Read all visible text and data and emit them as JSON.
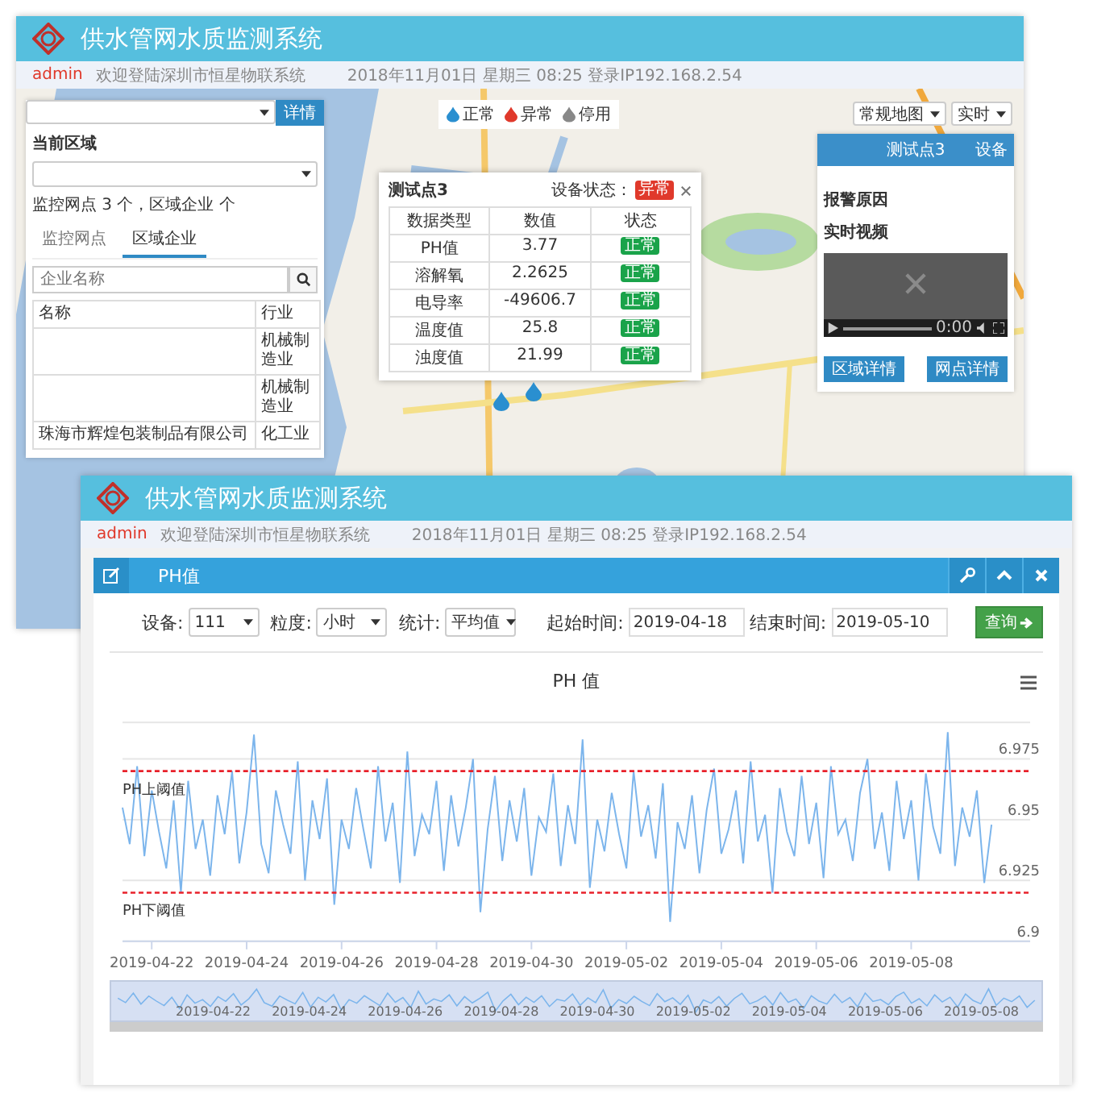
{
  "back_window": {
    "title": "供水管网水质监测系统",
    "info": {
      "user": "admin",
      "welcome": "欢迎登陆深圳市恒星物联系统",
      "session": "2018年11月01日 星期三 08:25 登录IP192.168.2.54"
    },
    "left_panel": {
      "detail_button": "详情",
      "area_label": "当前区域",
      "summary": "监控网点 3 个，区域企业 个",
      "tabs": [
        {
          "label": "监控网点",
          "selected": false
        },
        {
          "label": "区域企业",
          "selected": true
        }
      ],
      "search": {
        "placeholder": "企业名称"
      },
      "columns": [
        "名称",
        "行业"
      ],
      "rows": [
        {
          "industry": "机械制造业"
        },
        {
          "industry": "机械制造业"
        },
        {
          "name": "珠海市辉煌包装制品有限公司",
          "industry": "化工业"
        }
      ]
    },
    "legend": [
      {
        "label": "正常",
        "color": "#2a8fd0"
      },
      {
        "label": "异常",
        "color": "#e0392b"
      },
      {
        "label": "停用",
        "color": "#888888"
      }
    ],
    "map_controls": [
      "常规地图",
      "实时"
    ],
    "popup": {
      "title": "测试点3",
      "status_label": "设备状态：",
      "status": {
        "text": "异常",
        "color": "#e0392b"
      },
      "columns": [
        "数据类型",
        "数值",
        "状态"
      ],
      "rows": [
        {
          "type": "PH值",
          "value": "3.77",
          "status": "正常",
          "color": "#1aa34a"
        },
        {
          "type": "溶解氧",
          "value": "2.2625",
          "status": "正常",
          "color": "#1aa34a"
        },
        {
          "type": "电导率",
          "value": "-49606.7",
          "status": "正常",
          "color": "#1aa34a"
        },
        {
          "type": "温度值",
          "value": "25.8",
          "status": "正常",
          "color": "#1aa34a"
        },
        {
          "type": "浊度值",
          "value": "21.99",
          "status": "正常",
          "color": "#1aa34a"
        }
      ]
    },
    "station_panel": {
      "title": "测试点3",
      "link": "设备",
      "alarm_label": "报警原因",
      "video_label": "实时视频",
      "video_time": "0:00",
      "buttons": [
        "区域详情",
        "网点详情"
      ]
    }
  },
  "front_window": {
    "title": "供水管网水质监测系统",
    "info": {
      "user": "admin",
      "welcome": "欢迎登陆深圳市恒星物联系统",
      "session": "2018年11月01日 星期三 08:25 登录IP192.168.2.54"
    },
    "panel_title": "PH值",
    "filters": [
      {
        "kind": "select",
        "label": "设备:",
        "value": "111"
      },
      {
        "kind": "select",
        "label": "粒度:",
        "value": "小时"
      },
      {
        "kind": "select",
        "label": "统计:",
        "value": "平均值"
      },
      {
        "kind": "date",
        "label": "起始时间:",
        "value": "2019-04-18"
      },
      {
        "kind": "date",
        "label": "结束时间:",
        "value": "2019-05-10"
      }
    ],
    "query_button": "查询",
    "chart_data": {
      "type": "line",
      "title": "PH 值",
      "grid": true,
      "ylim": [
        6.9,
        6.99
      ],
      "categories": [
        null,
        null,
        null,
        null,
        "2019-04-22",
        null,
        null,
        null,
        null,
        null,
        null,
        null,
        null,
        null,
        null,
        null,
        null,
        "2019-04-24",
        null,
        null,
        null,
        null,
        null,
        null,
        null,
        null,
        null,
        null,
        null,
        null,
        "2019-04-26",
        null,
        null,
        null,
        null,
        null,
        null,
        null,
        null,
        null,
        null,
        null,
        null,
        "2019-04-28",
        null,
        null,
        null,
        null,
        null,
        null,
        null,
        null,
        null,
        null,
        null,
        null,
        "2019-04-30",
        null,
        null,
        null,
        null,
        null,
        null,
        null,
        null,
        null,
        null,
        null,
        null,
        "2019-05-02",
        null,
        null,
        null,
        null,
        null,
        null,
        null,
        null,
        null,
        null,
        null,
        null,
        "2019-05-04",
        null,
        null,
        null,
        null,
        null,
        null,
        null,
        null,
        null,
        null,
        null,
        null,
        "2019-05-06",
        null,
        null,
        null,
        null,
        null,
        null,
        null,
        null,
        null,
        null,
        null,
        null,
        "2019-05-08",
        null,
        null,
        null,
        null,
        null,
        null,
        null,
        null,
        null,
        null,
        null
      ],
      "yticks": [
        6.9,
        6.925,
        6.95,
        6.975
      ],
      "ref_lines": [
        {
          "axis": "y",
          "value": 6.97,
          "label": "PH上阈值",
          "color": "#e8202a"
        },
        {
          "axis": "y",
          "value": 6.92,
          "label": "PH下阈值",
          "color": "#e8202a"
        }
      ],
      "series": [
        {
          "color": "#7cb5ec",
          "values": [
            6.955,
            6.94,
            6.972,
            6.935,
            6.962,
            6.945,
            6.93,
            6.958,
            6.92,
            6.966,
            6.938,
            6.95,
            6.927,
            6.96,
            6.944,
            6.97,
            6.932,
            6.953,
            6.985,
            6.94,
            6.928,
            6.962,
            6.948,
            6.936,
            6.974,
            6.925,
            6.958,
            6.942,
            6.967,
            6.915,
            6.95,
            6.938,
            6.963,
            6.946,
            6.93,
            6.972,
            6.941,
            6.957,
            6.924,
            6.978,
            6.935,
            6.952,
            6.944,
            6.966,
            6.929,
            6.96,
            6.939,
            6.955,
            6.975,
            6.912,
            6.946,
            6.968,
            6.933,
            6.958,
            6.941,
            6.963,
            6.927,
            6.951,
            6.945,
            6.969,
            6.931,
            6.956,
            6.94,
            6.983,
            6.922,
            6.95,
            6.937,
            6.961,
            6.944,
            6.93,
            6.97,
            6.943,
            6.956,
            6.934,
            6.965,
            6.908,
            6.949,
            6.938,
            6.96,
            6.928,
            6.954,
            6.971,
            6.936,
            6.946,
            6.962,
            6.932,
            6.974,
            6.941,
            6.952,
            6.92,
            6.963,
            6.945,
            6.935,
            6.968,
            6.94,
            6.957,
            6.926,
            6.972,
            6.944,
            6.95,
            6.933,
            6.961,
            6.975,
            6.938,
            6.953,
            6.929,
            6.966,
            6.942,
            6.958,
            6.925,
            6.969,
            6.947,
            6.936,
            6.986,
            6.931,
            6.955,
            6.943,
            6.962,
            6.924,
            6.948
          ]
        }
      ]
    },
    "navigator": {
      "labels": [
        "2019-04-22",
        "2019-04-24",
        "2019-04-26",
        "2019-04-28",
        "2019-04-30",
        "2019-05-02",
        "2019-05-04",
        "2019-05-06",
        "2019-05-08"
      ]
    }
  }
}
